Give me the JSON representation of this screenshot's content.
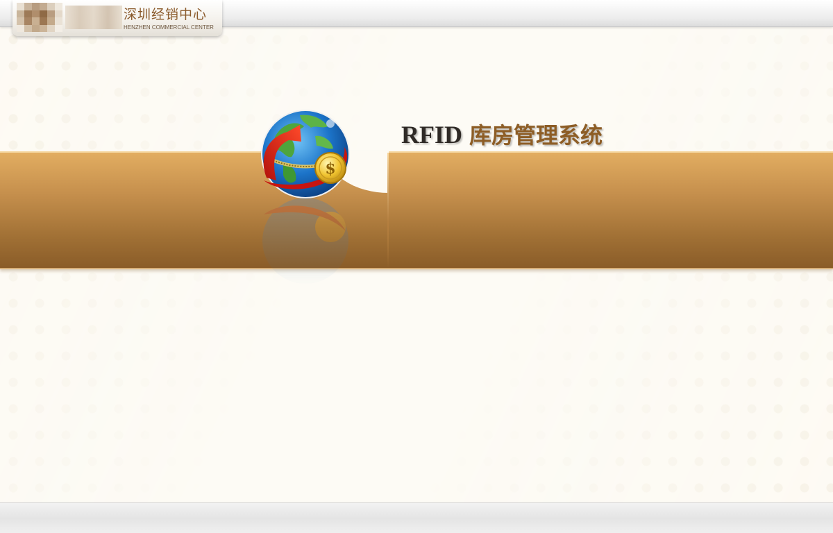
{
  "header": {
    "logo_cn": "深圳经销中心",
    "logo_en": "HENZHEN COMMERCIAL CENTER"
  },
  "banner": {
    "title_en": "RFID",
    "title_cn": "库房管理系统",
    "icon": "globe-dollar-arrow-icon"
  },
  "colors": {
    "band_top": "#e2ad61",
    "band_bottom": "#8a5c28",
    "title_cn": "#8d5d25",
    "title_en": "#2f2a26",
    "background": "#fdfaf3"
  }
}
